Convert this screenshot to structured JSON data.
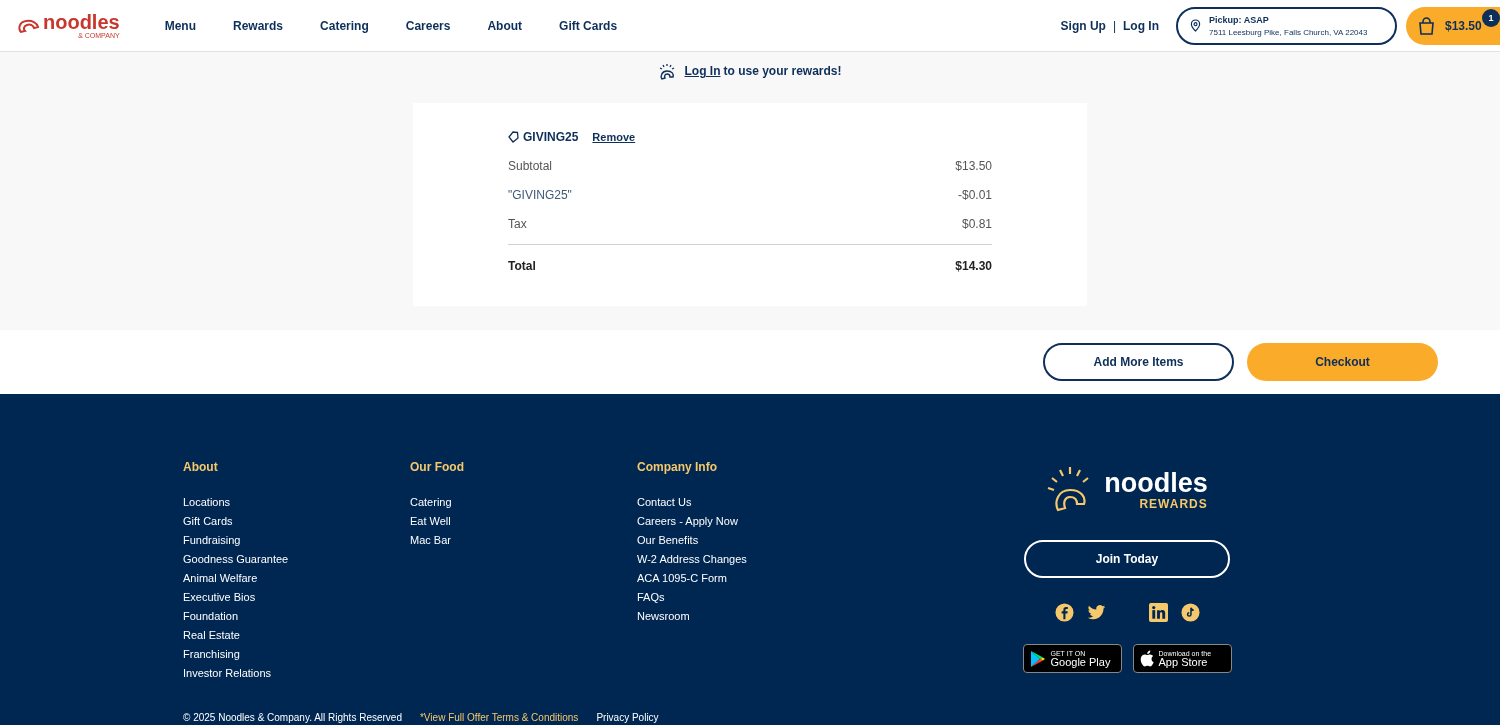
{
  "header": {
    "logo": {
      "name": "noodles",
      "tagline": "& COMPANY"
    },
    "nav": [
      "Menu",
      "Rewards",
      "Catering",
      "Careers",
      "About",
      "Gift Cards"
    ],
    "sign_up": "Sign Up",
    "separator": "|",
    "log_in": "Log In",
    "pickup": {
      "title": "Pickup: ASAP",
      "address": "7511 Leesburg Pike, Falls Church, VA 22043"
    },
    "cart": {
      "total": "$13.50",
      "count": "1"
    }
  },
  "rewards_banner": {
    "link": "Log In",
    "text": "to use your rewards!"
  },
  "summary": {
    "promo_code": "GIVING25",
    "remove": "Remove",
    "lines": [
      {
        "label": "Subtotal",
        "amount": "$13.50",
        "kind": "plain"
      },
      {
        "label": "\"GIVING25\"",
        "amount": "-$0.01",
        "kind": "discount"
      },
      {
        "label": "Tax",
        "amount": "$0.81",
        "kind": "plain"
      },
      {
        "label": "Total",
        "amount": "$14.30",
        "kind": "total"
      }
    ]
  },
  "actions": {
    "add_more": "Add More Items",
    "checkout": "Checkout"
  },
  "footer": {
    "columns": [
      {
        "title": "About",
        "links": [
          "Locations",
          "Gift Cards",
          "Fundraising",
          "Goodness Guarantee",
          "Animal Welfare",
          "Executive Bios",
          "Foundation",
          "Real Estate",
          "Franchising",
          "Investor Relations"
        ]
      },
      {
        "title": "Our Food",
        "links": [
          "Catering",
          "Eat Well",
          "Mac Bar"
        ]
      },
      {
        "title": "Company Info",
        "links": [
          "Contact Us",
          "Careers - Apply Now",
          "Our Benefits",
          "W-2 Address Changes",
          "ACA 1095-C Form",
          "FAQs",
          "Newsroom"
        ]
      }
    ],
    "rewards_logo": {
      "name": "noodles",
      "sub": "REWARDS"
    },
    "join": "Join Today",
    "social": [
      {
        "kind": "facebook"
      },
      {
        "kind": "twitter"
      },
      {
        "kind": "linkedin"
      },
      {
        "kind": "tiktok"
      }
    ],
    "stores": [
      {
        "kind": "google",
        "small": "GET IT ON",
        "big": "Google Play"
      },
      {
        "kind": "apple",
        "small": "Download on the",
        "big": "App Store"
      }
    ],
    "bottom": [
      "© 2025 Noodles & Company. All Rights Reserved",
      "*View Full Offer Terms & Conditions",
      "Privacy Policy"
    ]
  }
}
